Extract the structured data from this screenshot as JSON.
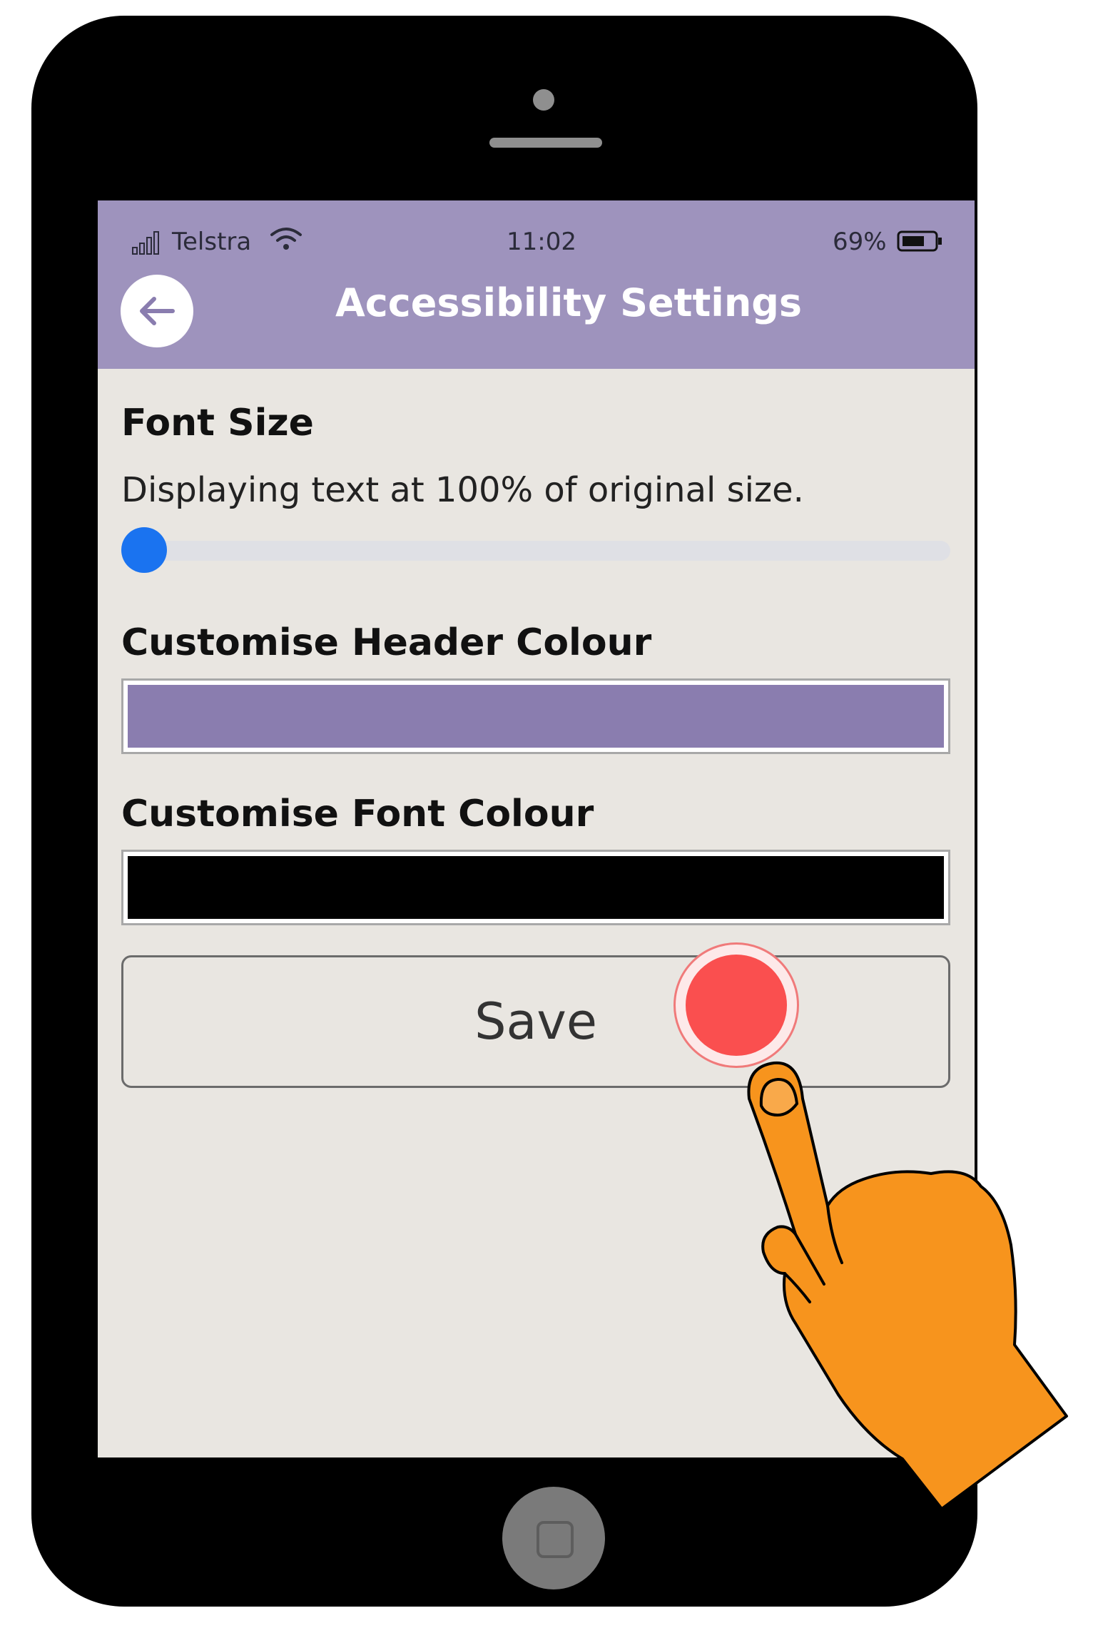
{
  "status_bar": {
    "carrier": "Telstra",
    "time": "11:02",
    "battery": "69%",
    "icons": [
      "signal-icon",
      "wifi-icon",
      "battery-icon"
    ]
  },
  "header": {
    "title": "Accessibility Settings",
    "back_icon": "arrow-left-icon",
    "color": "#9e93bd"
  },
  "font_size": {
    "label": "Font Size",
    "description": "Displaying text at 100% of original size.",
    "slider_value_fraction": 0.0,
    "slider_color": "#1a73f0"
  },
  "header_colour": {
    "label": "Customise Header Colour",
    "value": "#8a7daf"
  },
  "font_colour": {
    "label": "Customise Font Colour",
    "value": "#000000"
  },
  "save_button": {
    "label": "Save"
  },
  "overlay": {
    "tap_indicator_color": "#fa4f4f",
    "hand_color": "#f7941d"
  }
}
